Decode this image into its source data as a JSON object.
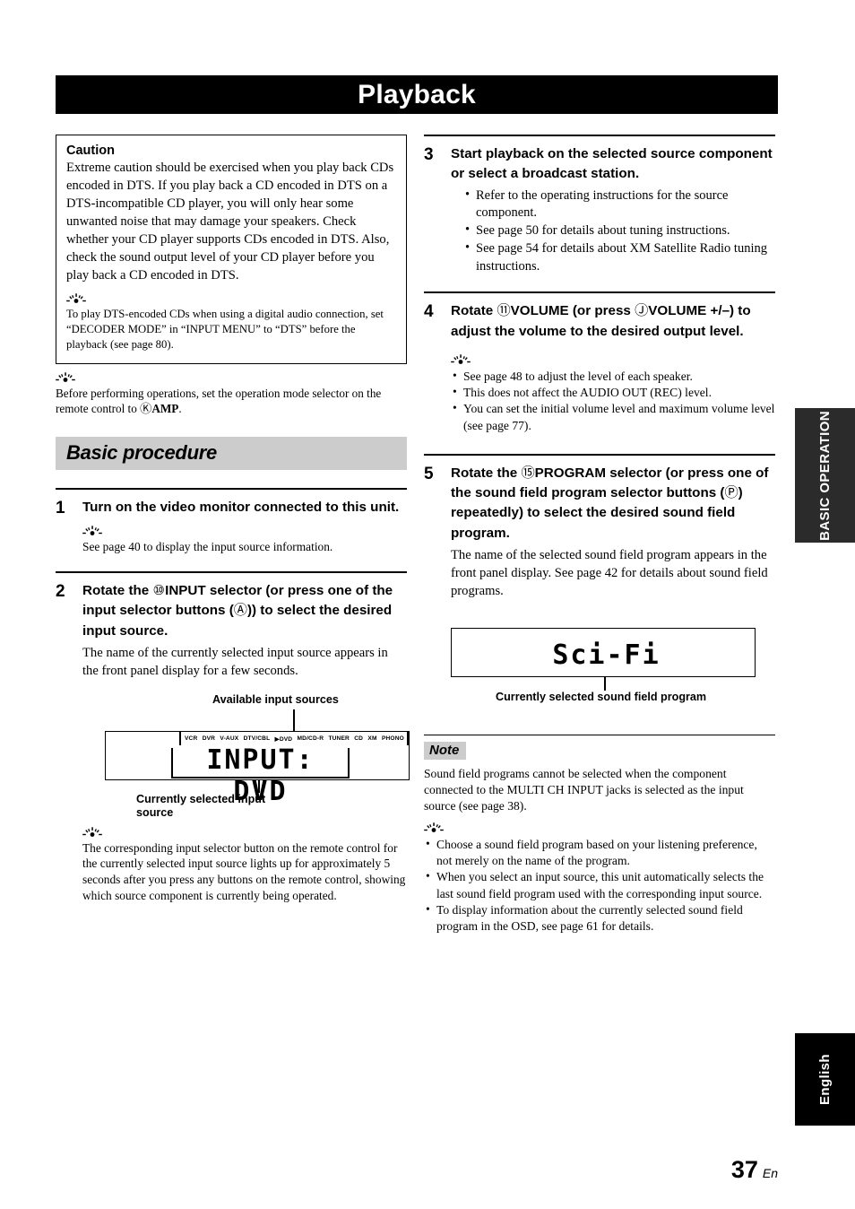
{
  "page": {
    "title": "Playback",
    "number": "37",
    "language_suffix": "En"
  },
  "side_tabs": {
    "basic_operation": "BASIC OPERATION",
    "english": "English"
  },
  "caution": {
    "heading": "Caution",
    "body": "Extreme caution should be exercised when you play back CDs encoded in DTS. If you play back a CD encoded in DTS on a DTS-incompatible CD player, you will only hear some unwanted noise that may damage your speakers. Check whether your CD player supports CDs encoded in DTS. Also, check the sound output level of your CD player before you play back a CD encoded in DTS.",
    "tip": "To play DTS-encoded CDs when using a digital audio connection, set “DECODER MODE” in “INPUT MENU” to “DTS” before the playback (see page 80)."
  },
  "intro_tip": {
    "text_before": "Before performing operations, set the operation mode selector on the remote control to ",
    "circled": "Ⓚ",
    "bold_label": "AMP",
    "text_after": "."
  },
  "section": {
    "title": "Basic procedure"
  },
  "steps": {
    "step1": {
      "number": "1",
      "title": "Turn on the video monitor connected to this unit.",
      "tip": "See page 40 to display the input source information."
    },
    "step2": {
      "number": "2",
      "title_part1": "Rotate the ",
      "title_circled": "⑩",
      "title_part2": "INPUT",
      "title_part3": " selector (or press one of the input selector buttons (",
      "title_circled2": "Ⓐ",
      "title_part4": ")) to select the desired input source.",
      "desc": "The name of the currently selected input source appears in the front panel display for a few seconds.",
      "tip": "The corresponding input selector button on the remote control for the currently selected input source lights up for approximately 5 seconds after you press any buttons on the remote control, showing which source component is currently being operated."
    },
    "step3": {
      "number": "3",
      "title": "Start playback on the selected source component or select a broadcast station.",
      "bullets": [
        "Refer to the operating instructions for the source component.",
        "See page 50 for details about tuning instructions.",
        "See page 54 for details about XM Satellite Radio tuning instructions."
      ]
    },
    "step4": {
      "number": "4",
      "title_part1": "Rotate ",
      "title_circled": "⑪",
      "title_part2": "VOLUME",
      "title_part3": " (or press ",
      "title_circled2": "Ⓙ",
      "title_part4": "VOLUME +/",
      "title_part5": "–) to adjust the volume to the desired output level.",
      "bullets": [
        "See page 48 to adjust the level of each speaker.",
        "This does not affect the AUDIO OUT (REC) level.",
        "You can set the initial volume level and maximum volume level (see page 77)."
      ]
    },
    "step5": {
      "number": "5",
      "title_part1": "Rotate the ",
      "title_circled": "⑮",
      "title_part2": "PROGRAM",
      "title_part3": " selector (or press one of the sound field program selector buttons (",
      "title_circled2": "Ⓟ",
      "title_part4": ") repeatedly) to select the desired sound field program.",
      "desc": "The name of the selected sound field program appears in the front panel display. See page 42 for details about sound field programs."
    }
  },
  "figures": {
    "input_display": {
      "caption_top": "Available input sources",
      "caption_bottom": "Currently selected input source",
      "display_text": "INPUT: DVD",
      "sources": [
        "VCR",
        "DVR",
        "V-AUX",
        "DTV/CBL",
        "▶DVD",
        "MD/CD-R",
        "TUNER",
        "CD",
        "XM",
        "PHONO"
      ]
    },
    "program_display": {
      "display_text": "Sci-Fi",
      "caption_bottom": "Currently selected sound field program"
    }
  },
  "note": {
    "label": "Note",
    "body": "Sound field programs cannot be selected when the component connected to the MULTI CH INPUT jacks is selected as the input source (see page 38).",
    "bullets": [
      "Choose a sound field program based on your listening preference, not merely on the name of the program.",
      "When you select an input source, this unit automatically selects the last sound field program used with the corresponding input source.",
      "To display information about the currently selected sound field program in the OSD, see page 61 for details."
    ]
  }
}
